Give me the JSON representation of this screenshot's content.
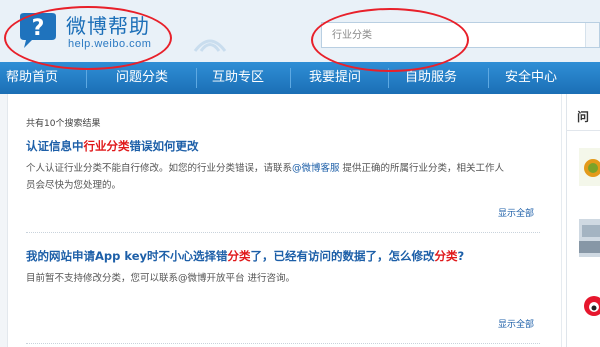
{
  "header": {
    "logo_title": "微博帮助",
    "logo_url": "help.weibo.com",
    "search_placeholder": "行业分类"
  },
  "nav": {
    "items": [
      {
        "label": "帮助首页"
      },
      {
        "label": "问题分类"
      },
      {
        "label": "互助专区"
      },
      {
        "label": "我要提问"
      },
      {
        "label": "自助服务"
      },
      {
        "label": "安全中心"
      }
    ]
  },
  "results": {
    "summary": "共有10个搜索结果",
    "items": [
      {
        "title_pre": "认证信息中",
        "title_kw": "行业分类",
        "title_post": "错误如何更改",
        "desc_line1_pre": "个人认证行业分类不能自行修改。如您的行业分类错误，请联系",
        "desc_link": "@微博客服",
        "desc_line1_post": " 提供正确的所属行业分类，相关工作人",
        "desc_line2": "员会尽快为您处理的。",
        "more": "显示全部"
      },
      {
        "title_pre": "我的网站申请App key时不小心选择错",
        "title_kw": "分类",
        "title_mid": "了，已经有访问的数据了，怎么修改",
        "title_kw2": "分类",
        "title_post": "?",
        "desc_line1": "目前暂不支持修改分类，您可以联系@微博开放平台 进行咨询。",
        "more": "显示全部"
      }
    ]
  },
  "sidebar": {
    "heading": "问"
  },
  "colors": {
    "nav_bg": "#1b6fb5",
    "link": "#1d5fa8",
    "keyword": "#e0191b",
    "annotation": "#e8202a"
  }
}
